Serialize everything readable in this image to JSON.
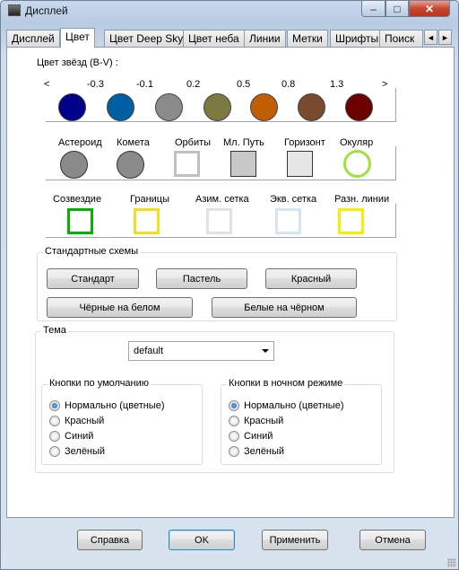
{
  "window": {
    "title": "Дисплей",
    "min": "–",
    "max": "□",
    "close": "✕"
  },
  "tabs": [
    "Дисплей",
    "Цвет",
    "Цвет Deep Sky",
    "Цвет неба",
    "Линии",
    "Метки",
    "Шрифты",
    "Поиск"
  ],
  "tab_scroll": {
    "left": "◄",
    "right": "►"
  },
  "star_colors": {
    "label": "Цвет звёзд (B-V) :",
    "less": "<",
    "more": ">",
    "values": [
      "-0.3",
      "-0.1",
      "0.2",
      "0.5",
      "0.8",
      "1.3"
    ],
    "colors": [
      "#00008b",
      "#005ea2",
      "#8b8b8b",
      "#7c7a41",
      "#bf5e04",
      "#7a4a2e",
      "#6b0000"
    ]
  },
  "objects": {
    "labels": [
      "Астероид",
      "Комета",
      "Орбиты",
      "Мл. Путь",
      "Горизонт",
      "Окуляр"
    ],
    "colors": [
      "#8a8a8a",
      "#8a8a8a",
      "#c0c0c0",
      "#c8c8c8",
      "#e6e6e6",
      "#9be33b"
    ]
  },
  "lines": {
    "labels": [
      "Созвездие",
      "Границы",
      "Азим. сетка",
      "Экв. сетка",
      "Разн. линии"
    ],
    "colors": [
      "#00b400",
      "#f0e01e",
      "#e2e2e2",
      "#d4e6ef",
      "#f4f000"
    ]
  },
  "schemes": {
    "title": "Стандартные схемы",
    "buttons": [
      "Стандарт",
      "Пастель",
      "Красный",
      "Чёрные на белом",
      "Белые на чёрном"
    ]
  },
  "theme": {
    "title": "Тема",
    "selected": "default",
    "default_buttons": {
      "title": "Кнопки по умолчанию",
      "options": [
        "Нормально (цветные)",
        "Красный",
        "Синий",
        "Зелёный"
      ],
      "selected_index": 0
    },
    "night_buttons": {
      "title": "Кнопки в ночном режиме",
      "options": [
        "Нормально (цветные)",
        "Красный",
        "Синий",
        "Зелёный"
      ],
      "selected_index": 0
    }
  },
  "footer": {
    "help": "Справка",
    "ok": "OK",
    "apply": "Применить",
    "cancel": "Отмена"
  }
}
